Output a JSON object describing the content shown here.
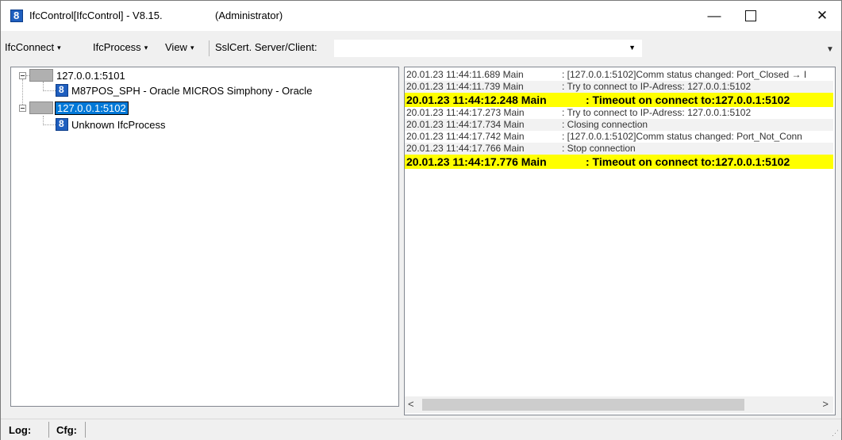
{
  "window": {
    "title": "IfcControl[IfcControl] - V8.15.",
    "admin": "(Administrator)",
    "app_icon_glyph": "8",
    "min_glyph": "—",
    "close_glyph": "✕"
  },
  "menu": {
    "items": [
      {
        "label": "IfcConnect",
        "caret": "▾"
      },
      {
        "label": "IfcProcess",
        "caret": "▾"
      },
      {
        "label": "View",
        "caret": "▾"
      }
    ],
    "ssl_label": "SslCert. Server/Client:",
    "server_value": "",
    "combo_arrow": "▼",
    "overflow_glyph": "▼"
  },
  "tree": {
    "nodes": [
      {
        "label": "127.0.0.1:5101",
        "children": [
          {
            "label": "M87POS_SPH - Oracle MICROS Simphony - Oracle",
            "icon": "ifc-8-icon"
          }
        ]
      },
      {
        "label": "127.0.0.1:5102",
        "selected": true,
        "children": [
          {
            "label": "Unknown IfcProcess",
            "icon": "ifc-8-icon"
          }
        ]
      }
    ]
  },
  "log": {
    "lines": [
      {
        "ts": "20.01.23 11:44:11.689 Main",
        "msg": ": [127.0.0.1:5102]Comm status changed: Port_Closed → I",
        "style": "normal"
      },
      {
        "ts": "20.01.23 11:44:11.739 Main",
        "msg": ": Try to connect to IP-Adress: 127.0.0.1:5102",
        "style": "alt"
      },
      {
        "ts": "20.01.23 11:44:12.248 Main",
        "msg": ": Timeout on connect to:127.0.0.1:5102",
        "style": "highlight"
      },
      {
        "ts": "20.01.23 11:44:17.273 Main",
        "msg": ": Try to connect to IP-Adress: 127.0.0.1:5102",
        "style": "normal"
      },
      {
        "ts": "20.01.23 11:44:17.734 Main",
        "msg": ": Closing connection",
        "style": "alt"
      },
      {
        "ts": "20.01.23 11:44:17.742 Main",
        "msg": ": [127.0.0.1:5102]Comm status changed: Port_Not_Conn",
        "style": "normal"
      },
      {
        "ts": "20.01.23 11:44:17.766 Main",
        "msg": ": Stop connection",
        "style": "alt"
      },
      {
        "ts": "20.01.23 11:44:17.776 Main",
        "msg": ": Timeout on connect to:127.0.0.1:5102",
        "style": "highlight"
      }
    ],
    "scroll_left": "<",
    "scroll_right": ">"
  },
  "status": {
    "log_label": "Log:",
    "cfg_label": "Cfg:",
    "grip": "⋰"
  },
  "colors": {
    "highlight": "#ffff00",
    "selection": "#0078d7",
    "ifc_icon": "#1f5fbf"
  }
}
